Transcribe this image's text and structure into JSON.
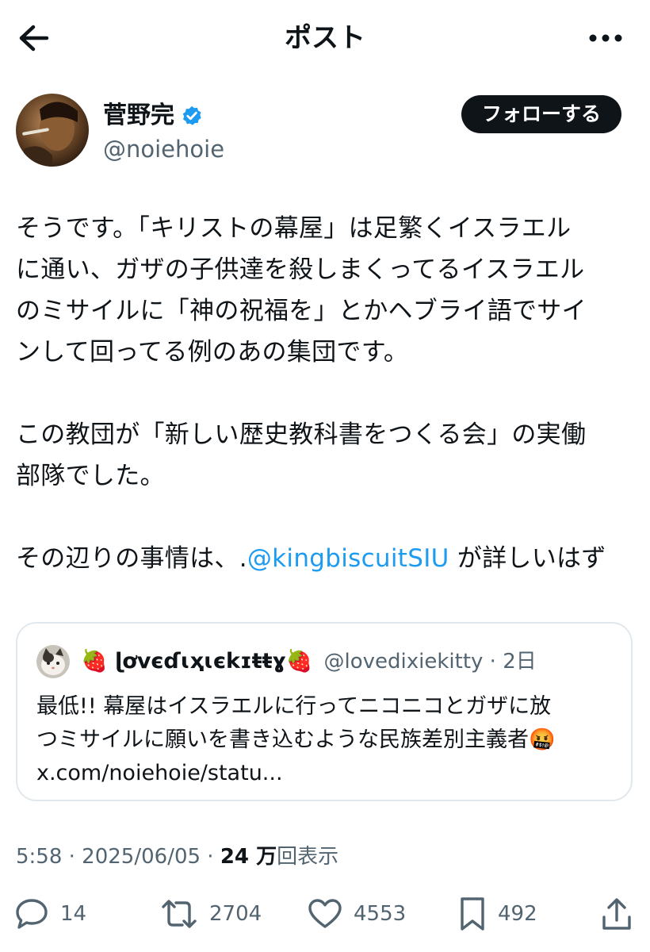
{
  "header": {
    "title": "ポスト"
  },
  "author": {
    "name": "菅野完",
    "handle": "@noiehoie",
    "follow_label": "フォローする",
    "verified": true
  },
  "post": {
    "paragraph1": [
      "そうです。「キリストの幕屋」は足繁くイスラエル",
      "に通い、ガザの子供達を殺しまくってるイスラエル",
      "のミサイルに「神の祝福を」とかヘブライ語でサイ",
      "ンして回ってる例のあの集団です。"
    ],
    "paragraph2": [
      "この教団が「新しい歴史教科書をつくる会」の実働",
      "部隊でした。"
    ],
    "paragraph3_before": "その辺りの事情は、.",
    "mention": "@kingbiscuitSIU",
    "paragraph3_after": " が詳しいはず"
  },
  "quote": {
    "name": "🍓 ɭơvєɗɩҳɩєkɪŧŧɣ🍓",
    "handle_time": "@lovedixiekitty · 2日",
    "lines": [
      "最低!! 幕屋はイスラエルに行ってニコニコとガザに放",
      "つミサイルに願いを書き込むような民族差別主義者🤬",
      "x.com/noiehoie/statu..."
    ]
  },
  "meta": {
    "time": "5:58 · 2025/06/05 · ",
    "views": "24 万",
    "views_label": "回表示"
  },
  "actions": {
    "reply_count": "14",
    "repost_count": "2704",
    "like_count": "4553",
    "bookmark_count": "492"
  },
  "colors": {
    "accent": "#1d9bf0",
    "text": "#0f1419",
    "secondary": "#536471",
    "border": "#e1e8ed"
  }
}
